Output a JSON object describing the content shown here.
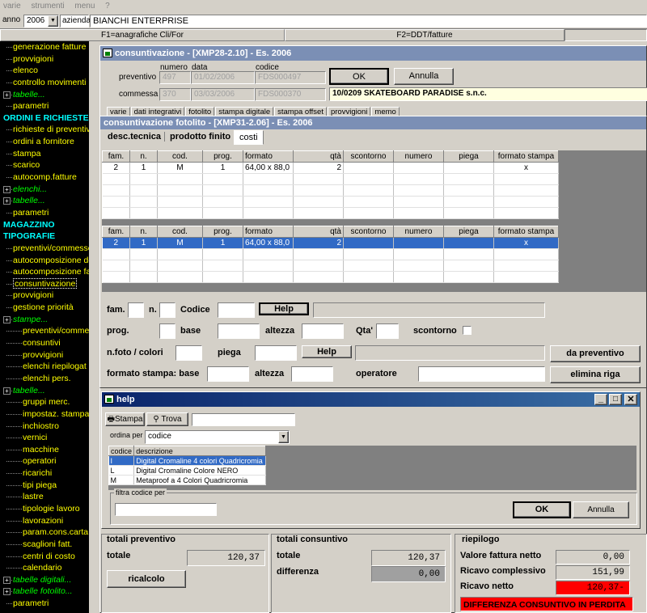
{
  "menu": [
    "varie",
    "strumenti",
    "menu",
    "?"
  ],
  "top": {
    "anno_label": "anno",
    "anno_value": "2006",
    "azienda_label": "azienda",
    "azienda_value": "BIANCHI ENTERPRISE"
  },
  "fkeys": {
    "f1": "F1=anagrafiche Cli/For",
    "f2": "F2=DDT/fatture"
  },
  "sidebar": [
    {
      "t": "generazione fatture",
      "s": "y"
    },
    {
      "t": "provvigioni",
      "s": "y"
    },
    {
      "t": "elenco",
      "s": "y"
    },
    {
      "t": "controllo movimenti",
      "s": "y"
    },
    {
      "t": "tabelle...",
      "s": "g"
    },
    {
      "t": "parametri",
      "s": "y"
    },
    {
      "t": "ORDINI E RICHIESTE",
      "s": "c"
    },
    {
      "t": "richieste di preventivo",
      "s": "y"
    },
    {
      "t": "ordini a fornitore",
      "s": "y"
    },
    {
      "t": "stampa",
      "s": "y"
    },
    {
      "t": "scarico",
      "s": "y"
    },
    {
      "t": "autocomp.fatture",
      "s": "y"
    },
    {
      "t": "elenchi...",
      "s": "g"
    },
    {
      "t": "tabelle...",
      "s": "g"
    },
    {
      "t": "parametri",
      "s": "y"
    },
    {
      "t": "MAGAZZINO",
      "s": "c"
    },
    {
      "t": "TIPOGRAFIE",
      "s": "c"
    },
    {
      "t": "preventivi/commesse",
      "s": "y"
    },
    {
      "t": "autocomposizione de",
      "s": "y"
    },
    {
      "t": "autocomposizione fa",
      "s": "y"
    },
    {
      "t": "consuntivazione",
      "s": "y",
      "sel": true
    },
    {
      "t": "provvigioni",
      "s": "y"
    },
    {
      "t": "gestione priorità",
      "s": "y"
    },
    {
      "t": "stampe...",
      "s": "g"
    },
    {
      "t": "preventivi/comme",
      "s": "y",
      "ind": 1
    },
    {
      "t": "consuntivi",
      "s": "y",
      "ind": 1
    },
    {
      "t": "provvigioni",
      "s": "y",
      "ind": 1
    },
    {
      "t": "elenchi riepilogat",
      "s": "y",
      "ind": 1
    },
    {
      "t": "elenchi pers.",
      "s": "y",
      "ind": 1
    },
    {
      "t": "tabelle...",
      "s": "g"
    },
    {
      "t": "gruppi merc.",
      "s": "y",
      "ind": 1
    },
    {
      "t": "impostaz. stampa",
      "s": "y",
      "ind": 1
    },
    {
      "t": "inchiostro",
      "s": "y",
      "ind": 1
    },
    {
      "t": "vernici",
      "s": "y",
      "ind": 1
    },
    {
      "t": "macchine",
      "s": "y",
      "ind": 1
    },
    {
      "t": "operatori",
      "s": "y",
      "ind": 1
    },
    {
      "t": "ricarichi",
      "s": "y",
      "ind": 1
    },
    {
      "t": "tipi piega",
      "s": "y",
      "ind": 1
    },
    {
      "t": "lastre",
      "s": "y",
      "ind": 1
    },
    {
      "t": "tipologie lavoro",
      "s": "y",
      "ind": 1
    },
    {
      "t": "lavorazioni",
      "s": "y",
      "ind": 1
    },
    {
      "t": "param.cons.carta",
      "s": "y",
      "ind": 1
    },
    {
      "t": "scaglioni fatt.",
      "s": "y",
      "ind": 1
    },
    {
      "t": "centri di costo",
      "s": "y",
      "ind": 1
    },
    {
      "t": "calendario",
      "s": "y",
      "ind": 1
    },
    {
      "t": "tabelle digitali...",
      "s": "g"
    },
    {
      "t": "tabelle fotolito...",
      "s": "g"
    },
    {
      "t": "parametri",
      "s": "y"
    }
  ],
  "main": {
    "title": "consuntivazione - [XMP28-2.10] - Es. 2006",
    "h_numero": "numero",
    "h_data": "data",
    "h_codice": "codice",
    "preventivo_label": "preventivo",
    "prev_num": "497",
    "prev_data": "01/02/2006",
    "prev_cod": "FDS000497",
    "commessa_label": "commessa",
    "comm_num": "370",
    "comm_data": "03/03/2006",
    "comm_cod": "FDS000370",
    "ok": "OK",
    "annulla": "Annulla",
    "cliente": "10/0209  SKATEBOARD PARADISE s.n.c.",
    "tabs": [
      "varie",
      "dati integrativi",
      "fotolito",
      "stampa digitale",
      "stampa offset",
      "provvigioni",
      "memo"
    ]
  },
  "sub": {
    "title": "consuntivazione fotolito - [XMP31-2.06] - Es. 2006",
    "tabs": [
      "desc.tecnica",
      "prodotto finito",
      "costi"
    ],
    "columns": [
      "fam.",
      "n.",
      "cod.",
      "prog.",
      "formato",
      "qtà",
      "scontorno",
      "numero",
      "piega",
      "formato stampa"
    ],
    "row": [
      "2",
      "1",
      "M",
      "1",
      "64,00 x 88,0",
      "2",
      "",
      "",
      "",
      "x"
    ],
    "f_fam": "fam.",
    "f_n": "n.",
    "f_codice": "Codice",
    "help": "Help",
    "f_prog": "prog.",
    "f_base": "base",
    "f_altezza": "altezza",
    "f_qta": "Qta'",
    "f_scontorno": "scontorno",
    "f_nfoto": "n.foto / colori",
    "f_piega": "piega",
    "da_preventivo": "da preventivo",
    "f_formato": "formato stampa: base",
    "f_altezza2": "altezza",
    "f_operatore": "operatore",
    "elimina_riga": "elimina riga"
  },
  "help": {
    "title": "help",
    "stampa": "Stampa",
    "trova": "Trova",
    "ordina_label": "ordina per",
    "ordina_value": "codice",
    "cols": [
      "codice",
      "descrizione"
    ],
    "rows": [
      [
        "I",
        "Digital Cromaline 4 colori Quadricromia"
      ],
      [
        "L",
        "Digital Cromaline Colore NERO"
      ],
      [
        "M",
        "Metaproof a 4 Colori Quadricromia"
      ]
    ],
    "filtra": "filtra codice per",
    "ok": "OK",
    "annulla": "Annulla"
  },
  "totals": {
    "prev_title": "totali preventivo",
    "totale_label": "totale",
    "prev_totale": "120,37",
    "ricalcolo": "ricalcolo",
    "cons_title": "totali consuntivo",
    "cons_totale_label": "totale",
    "cons_totale": "120,37",
    "differenza_label": "differenza",
    "differenza": "0,00",
    "riep_title": "riepilogo",
    "vfn_label": "Valore fattura netto",
    "vfn": "0,00",
    "rc_label": "Ricavo complessivo",
    "rc": "151,99",
    "rn_label": "Ricavo netto",
    "rn": "120,37-",
    "warning": "DIFFERENZA CONSUNTIVO IN PERDITA"
  },
  "colors": {
    "title_active": "#0a246a",
    "title_inactive": "#7b8fb5",
    "selection": "#316ac5",
    "loss": "#ff0000"
  }
}
